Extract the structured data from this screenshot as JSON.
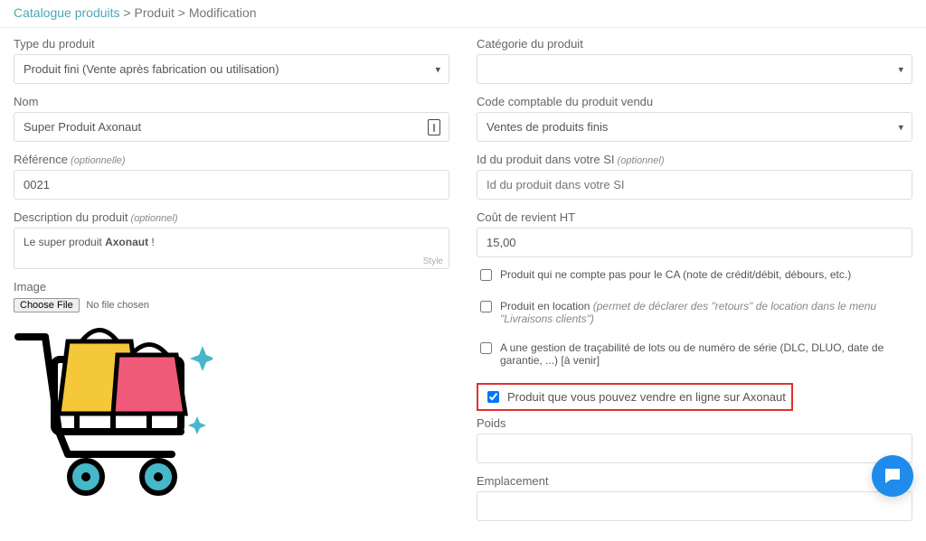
{
  "breadcrumb": {
    "root": "Catalogue produits",
    "sep1": " > ",
    "mid": "Produit",
    "sep2": " > ",
    "leaf": "Modification"
  },
  "left": {
    "type_label": "Type du produit",
    "type_value": "Produit fini (Vente après fabrication ou utilisation)",
    "name_label": "Nom",
    "name_value": "Super Produit Axonaut",
    "ref_label": "Référence",
    "ref_opt": " (optionnelle)",
    "ref_value": "0021",
    "desc_label": "Description du produit",
    "desc_opt": " (optionnel)",
    "desc_prefix": "Le super produit ",
    "desc_bold": "Axonaut",
    "desc_suffix": " !",
    "desc_style": "Style",
    "image_label": "Image",
    "choose_file": "Choose File",
    "no_file": "No file chosen"
  },
  "right": {
    "cat_label": "Catégorie du produit",
    "cat_value": "",
    "code_label": "Code comptable du produit vendu",
    "code_value": "Ventes de produits finis",
    "si_label": "Id du produit dans votre SI",
    "si_opt": " (optionnel)",
    "si_placeholder": "Id du produit dans votre SI",
    "cost_label": "Coût de revient HT",
    "cost_value": "15,00",
    "chk_ca": "Produit qui ne compte pas pour le CA (note de crédit/débit, débours, etc.)",
    "chk_loc_pre": "Produit en location ",
    "chk_loc_sub": "(permet de déclarer des \"retours\" de location dans le menu \"Livraisons clients\")",
    "chk_trace": "A une gestion de traçabilité de lots ou de numéro de série (DLC, DLUO, date de garantie, ...) [à venir]",
    "chk_online": "Produit que vous pouvez vendre en ligne sur Axonaut",
    "poids_label": "Poids",
    "emplacement_label": "Emplacement"
  }
}
